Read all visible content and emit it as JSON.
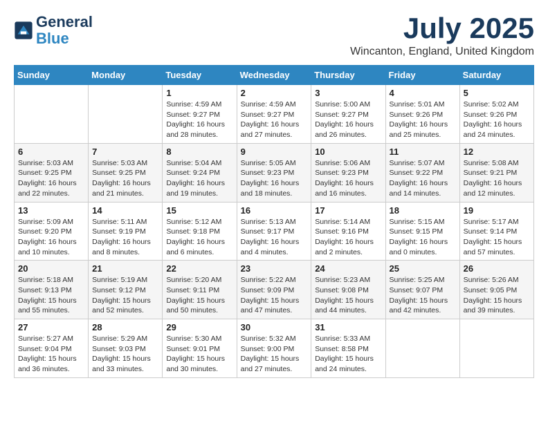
{
  "logo": {
    "line1": "General",
    "line2": "Blue"
  },
  "title": {
    "month_year": "July 2025",
    "location": "Wincanton, England, United Kingdom"
  },
  "days_of_week": [
    "Sunday",
    "Monday",
    "Tuesday",
    "Wednesday",
    "Thursday",
    "Friday",
    "Saturday"
  ],
  "weeks": [
    [
      {
        "day": "",
        "sunrise": "",
        "sunset": "",
        "daylight": ""
      },
      {
        "day": "",
        "sunrise": "",
        "sunset": "",
        "daylight": ""
      },
      {
        "day": "1",
        "sunrise": "Sunrise: 4:59 AM",
        "sunset": "Sunset: 9:27 PM",
        "daylight": "Daylight: 16 hours and 28 minutes."
      },
      {
        "day": "2",
        "sunrise": "Sunrise: 4:59 AM",
        "sunset": "Sunset: 9:27 PM",
        "daylight": "Daylight: 16 hours and 27 minutes."
      },
      {
        "day": "3",
        "sunrise": "Sunrise: 5:00 AM",
        "sunset": "Sunset: 9:27 PM",
        "daylight": "Daylight: 16 hours and 26 minutes."
      },
      {
        "day": "4",
        "sunrise": "Sunrise: 5:01 AM",
        "sunset": "Sunset: 9:26 PM",
        "daylight": "Daylight: 16 hours and 25 minutes."
      },
      {
        "day": "5",
        "sunrise": "Sunrise: 5:02 AM",
        "sunset": "Sunset: 9:26 PM",
        "daylight": "Daylight: 16 hours and 24 minutes."
      }
    ],
    [
      {
        "day": "6",
        "sunrise": "Sunrise: 5:03 AM",
        "sunset": "Sunset: 9:25 PM",
        "daylight": "Daylight: 16 hours and 22 minutes."
      },
      {
        "day": "7",
        "sunrise": "Sunrise: 5:03 AM",
        "sunset": "Sunset: 9:25 PM",
        "daylight": "Daylight: 16 hours and 21 minutes."
      },
      {
        "day": "8",
        "sunrise": "Sunrise: 5:04 AM",
        "sunset": "Sunset: 9:24 PM",
        "daylight": "Daylight: 16 hours and 19 minutes."
      },
      {
        "day": "9",
        "sunrise": "Sunrise: 5:05 AM",
        "sunset": "Sunset: 9:23 PM",
        "daylight": "Daylight: 16 hours and 18 minutes."
      },
      {
        "day": "10",
        "sunrise": "Sunrise: 5:06 AM",
        "sunset": "Sunset: 9:23 PM",
        "daylight": "Daylight: 16 hours and 16 minutes."
      },
      {
        "day": "11",
        "sunrise": "Sunrise: 5:07 AM",
        "sunset": "Sunset: 9:22 PM",
        "daylight": "Daylight: 16 hours and 14 minutes."
      },
      {
        "day": "12",
        "sunrise": "Sunrise: 5:08 AM",
        "sunset": "Sunset: 9:21 PM",
        "daylight": "Daylight: 16 hours and 12 minutes."
      }
    ],
    [
      {
        "day": "13",
        "sunrise": "Sunrise: 5:09 AM",
        "sunset": "Sunset: 9:20 PM",
        "daylight": "Daylight: 16 hours and 10 minutes."
      },
      {
        "day": "14",
        "sunrise": "Sunrise: 5:11 AM",
        "sunset": "Sunset: 9:19 PM",
        "daylight": "Daylight: 16 hours and 8 minutes."
      },
      {
        "day": "15",
        "sunrise": "Sunrise: 5:12 AM",
        "sunset": "Sunset: 9:18 PM",
        "daylight": "Daylight: 16 hours and 6 minutes."
      },
      {
        "day": "16",
        "sunrise": "Sunrise: 5:13 AM",
        "sunset": "Sunset: 9:17 PM",
        "daylight": "Daylight: 16 hours and 4 minutes."
      },
      {
        "day": "17",
        "sunrise": "Sunrise: 5:14 AM",
        "sunset": "Sunset: 9:16 PM",
        "daylight": "Daylight: 16 hours and 2 minutes."
      },
      {
        "day": "18",
        "sunrise": "Sunrise: 5:15 AM",
        "sunset": "Sunset: 9:15 PM",
        "daylight": "Daylight: 16 hours and 0 minutes."
      },
      {
        "day": "19",
        "sunrise": "Sunrise: 5:17 AM",
        "sunset": "Sunset: 9:14 PM",
        "daylight": "Daylight: 15 hours and 57 minutes."
      }
    ],
    [
      {
        "day": "20",
        "sunrise": "Sunrise: 5:18 AM",
        "sunset": "Sunset: 9:13 PM",
        "daylight": "Daylight: 15 hours and 55 minutes."
      },
      {
        "day": "21",
        "sunrise": "Sunrise: 5:19 AM",
        "sunset": "Sunset: 9:12 PM",
        "daylight": "Daylight: 15 hours and 52 minutes."
      },
      {
        "day": "22",
        "sunrise": "Sunrise: 5:20 AM",
        "sunset": "Sunset: 9:11 PM",
        "daylight": "Daylight: 15 hours and 50 minutes."
      },
      {
        "day": "23",
        "sunrise": "Sunrise: 5:22 AM",
        "sunset": "Sunset: 9:09 PM",
        "daylight": "Daylight: 15 hours and 47 minutes."
      },
      {
        "day": "24",
        "sunrise": "Sunrise: 5:23 AM",
        "sunset": "Sunset: 9:08 PM",
        "daylight": "Daylight: 15 hours and 44 minutes."
      },
      {
        "day": "25",
        "sunrise": "Sunrise: 5:25 AM",
        "sunset": "Sunset: 9:07 PM",
        "daylight": "Daylight: 15 hours and 42 minutes."
      },
      {
        "day": "26",
        "sunrise": "Sunrise: 5:26 AM",
        "sunset": "Sunset: 9:05 PM",
        "daylight": "Daylight: 15 hours and 39 minutes."
      }
    ],
    [
      {
        "day": "27",
        "sunrise": "Sunrise: 5:27 AM",
        "sunset": "Sunset: 9:04 PM",
        "daylight": "Daylight: 15 hours and 36 minutes."
      },
      {
        "day": "28",
        "sunrise": "Sunrise: 5:29 AM",
        "sunset": "Sunset: 9:03 PM",
        "daylight": "Daylight: 15 hours and 33 minutes."
      },
      {
        "day": "29",
        "sunrise": "Sunrise: 5:30 AM",
        "sunset": "Sunset: 9:01 PM",
        "daylight": "Daylight: 15 hours and 30 minutes."
      },
      {
        "day": "30",
        "sunrise": "Sunrise: 5:32 AM",
        "sunset": "Sunset: 9:00 PM",
        "daylight": "Daylight: 15 hours and 27 minutes."
      },
      {
        "day": "31",
        "sunrise": "Sunrise: 5:33 AM",
        "sunset": "Sunset: 8:58 PM",
        "daylight": "Daylight: 15 hours and 24 minutes."
      },
      {
        "day": "",
        "sunrise": "",
        "sunset": "",
        "daylight": ""
      },
      {
        "day": "",
        "sunrise": "",
        "sunset": "",
        "daylight": ""
      }
    ]
  ]
}
